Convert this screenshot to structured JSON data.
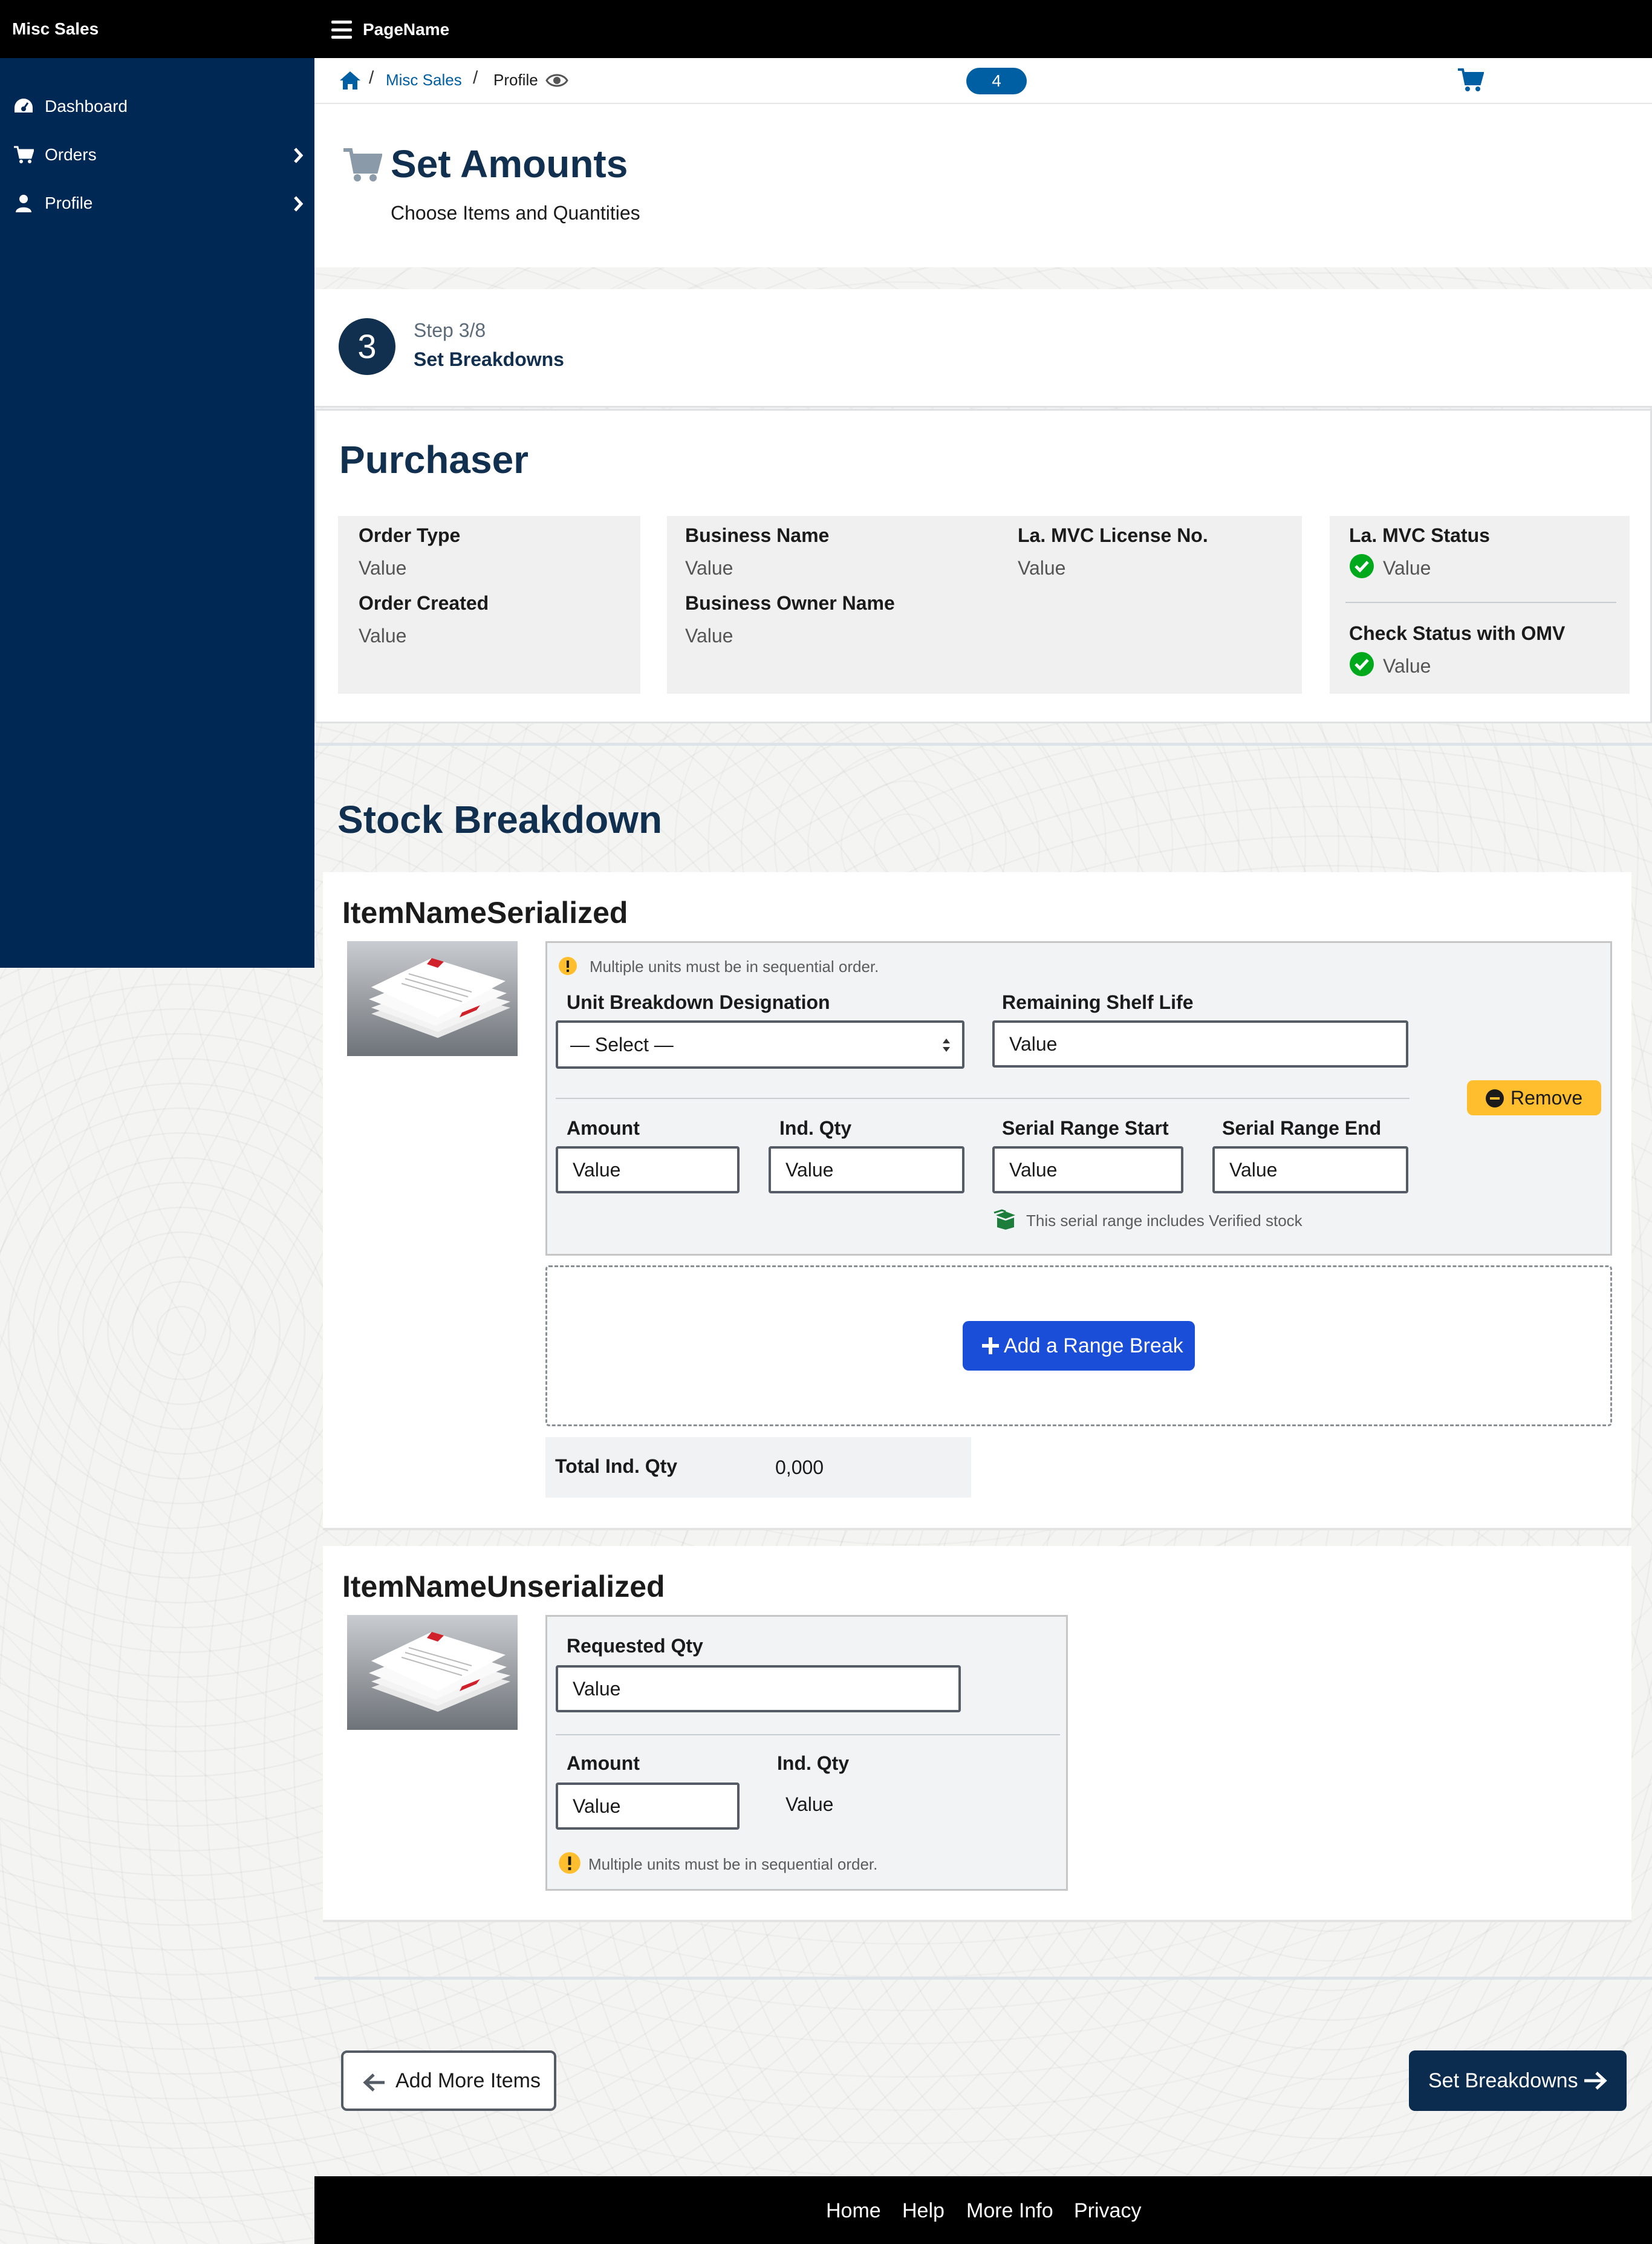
{
  "header": {
    "app_title": "Misc Sales",
    "page_name": "PageName"
  },
  "sidebar": {
    "items": [
      {
        "label": "Dashboard",
        "icon": "dashboard-icon",
        "has_submenu": false
      },
      {
        "label": "Orders",
        "icon": "cart-icon",
        "has_submenu": true
      },
      {
        "label": "Profile",
        "icon": "user-icon",
        "has_submenu": true
      }
    ]
  },
  "breadcrumb": {
    "link": "Misc Sales",
    "current": "Profile",
    "separator": "/"
  },
  "cart": {
    "count": "4"
  },
  "hero": {
    "title": "Set Amounts",
    "subtitle": "Choose Items and Quantities"
  },
  "step": {
    "number": "3",
    "count": "Step 3/8",
    "title": "Set Breakdowns"
  },
  "purchaser": {
    "heading": "Purchaser",
    "order_type_label": "Order Type",
    "order_type_value": "Value",
    "order_created_label": "Order Created",
    "order_created_value": "Value",
    "business_name_label": "Business Name",
    "business_name_value": "Value",
    "license_label": "La. MVC License No.",
    "license_value": "Value",
    "owner_label": "Business Owner Name",
    "owner_value": "Value",
    "mvc_status_label": "La. MVC Status",
    "mvc_status_value": "Value",
    "omv_status_label": "Check Status with OMV",
    "omv_status_value": "Value"
  },
  "stock": {
    "heading": "Stock Breakdown",
    "serialized": {
      "name": "ItemNameSerialized",
      "hint": "Multiple units must be in sequential order.",
      "designation_label": "Unit Breakdown Designation",
      "designation_value": "— Select —",
      "shelf_life_label": "Remaining Shelf Life",
      "shelf_life_value": "Value",
      "amount_label": "Amount",
      "amount_value": "Value",
      "ind_qty_label": "Ind. Qty",
      "ind_qty_value": "Value",
      "serial_start_label": "Serial Range Start",
      "serial_start_value": "Value",
      "serial_end_label": "Serial Range End",
      "serial_end_value": "Value",
      "verified_note": "This serial range includes Verified stock",
      "remove_label": "Remove",
      "add_range_label": "Add a Range Break",
      "total_label": "Total Ind. Qty",
      "total_value": "0,000"
    },
    "unserialized": {
      "name": "ItemNameUnserialized",
      "requested_label": "Requested Qty",
      "requested_value": "Value",
      "amount_label": "Amount",
      "amount_value": "Value",
      "ind_qty_label": "Ind. Qty",
      "ind_qty_value": "Value",
      "hint": "Multiple units must be in sequential order."
    }
  },
  "actions": {
    "back_label": "Add More Items",
    "next_label": "Set Breakdowns"
  },
  "footer": {
    "links": [
      "Home",
      "Help",
      "More Info",
      "Privacy"
    ]
  },
  "colors": {
    "navy": "#002855",
    "heading": "#112f4e",
    "link": "#005ea2",
    "primary_button": "#1a4ed8",
    "warning": "#ffbe2e",
    "success": "#00a91c"
  }
}
